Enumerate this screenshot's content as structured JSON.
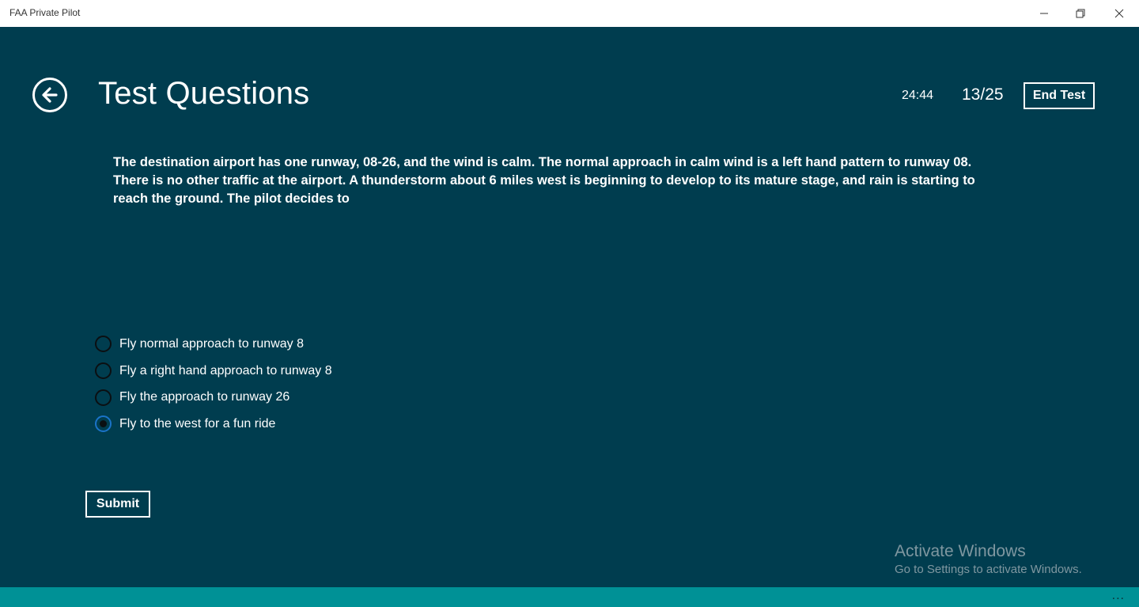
{
  "window": {
    "title": "FAA Private Pilot"
  },
  "header": {
    "title": "Test Questions",
    "timer": "24:44",
    "progress": "13/25",
    "end_test_label": "End Test"
  },
  "question": {
    "text": "The destination airport has one runway, 08-26, and the wind is calm. The normal approach in calm wind is a left hand pattern to runway 08. There is no other traffic at the airport. A thunderstorm about 6 miles west is beginning to develop to its mature stage, and rain is starting to reach the ground. The pilot decides to"
  },
  "answers": [
    {
      "label": "Fly normal approach to runway 8",
      "selected": false
    },
    {
      "label": "Fly a right hand approach to runway 8",
      "selected": false
    },
    {
      "label": "Fly the approach to runway 26",
      "selected": false
    },
    {
      "label": "Fly to the west for a fun ride",
      "selected": true
    }
  ],
  "submit_label": "Submit",
  "watermark": {
    "title": "Activate Windows",
    "subtitle": "Go to Settings to activate Windows."
  },
  "appbar": {
    "more_label": "..."
  },
  "colors": {
    "background": "#003d4f",
    "appbar": "#009196",
    "radio_selected_ring": "#1a73c8"
  }
}
